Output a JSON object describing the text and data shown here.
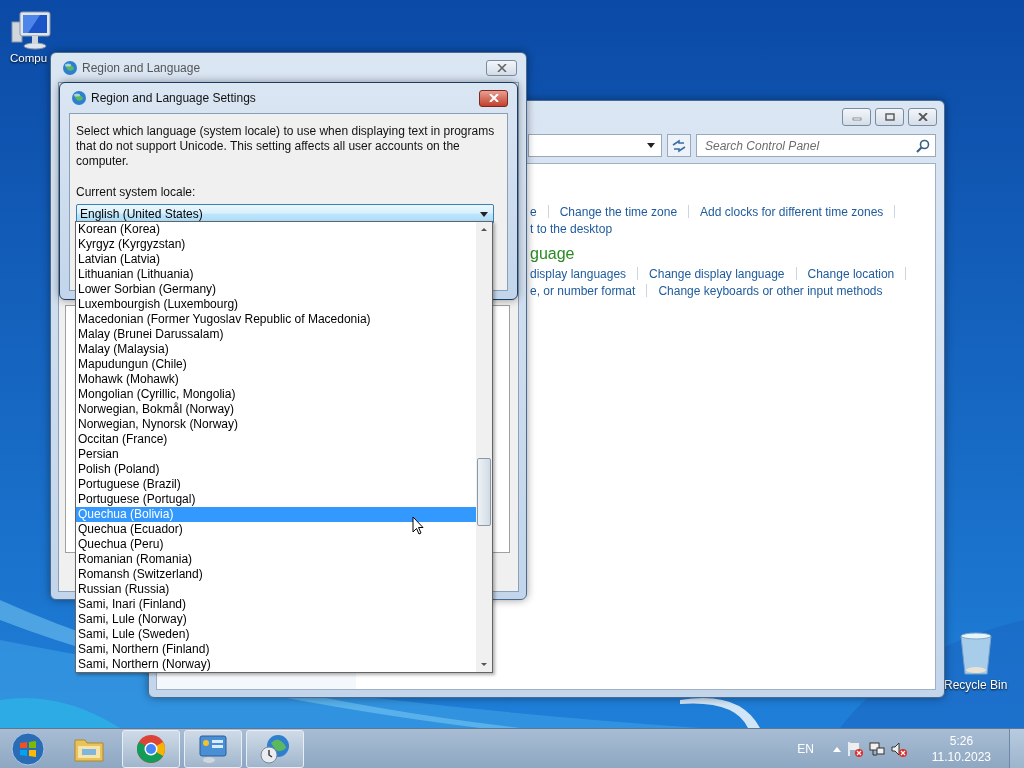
{
  "desktop_icons": [
    {
      "kind": "computer",
      "label": "Compu"
    },
    {
      "kind": "recycle",
      "label": "Recycle Bin"
    }
  ],
  "control_panel": {
    "search": {
      "placeholder": "Search Control Panel"
    },
    "rows": [
      {
        "kind": "links",
        "trailing_separator": true,
        "links": [
          "e",
          "Change the time zone",
          "Add clocks for different time zones"
        ]
      },
      {
        "kind": "links",
        "trailing_separator": false,
        "links": [
          "t to the desktop"
        ]
      },
      {
        "kind": "heading",
        "text": "guage"
      },
      {
        "kind": "links",
        "trailing_separator": true,
        "links": [
          "display languages",
          "Change display language",
          "Change location"
        ]
      },
      {
        "kind": "links",
        "trailing_separator": false,
        "links": [
          "e, or number format",
          "Change keyboards or other input methods"
        ]
      }
    ]
  },
  "region_dialog": {
    "title": "Region and Language"
  },
  "settings_dialog": {
    "title": "Region and Language Settings",
    "description": "Select which language (system locale) to use when displaying text in programs that do not support Unicode. This setting affects all user accounts on the computer.",
    "locale_label": "Current system locale:",
    "locale_value": "English (United States)",
    "options": [
      {
        "label": "Korean (Korea)",
        "selected": false
      },
      {
        "label": "Kyrgyz (Kyrgyzstan)",
        "selected": false
      },
      {
        "label": "Latvian (Latvia)",
        "selected": false
      },
      {
        "label": "Lithuanian (Lithuania)",
        "selected": false
      },
      {
        "label": "Lower Sorbian (Germany)",
        "selected": false
      },
      {
        "label": "Luxembourgish (Luxembourg)",
        "selected": false
      },
      {
        "label": "Macedonian (Former Yugoslav Republic of Macedonia)",
        "selected": false
      },
      {
        "label": "Malay (Brunei Darussalam)",
        "selected": false
      },
      {
        "label": "Malay (Malaysia)",
        "selected": false
      },
      {
        "label": "Mapudungun (Chile)",
        "selected": false
      },
      {
        "label": "Mohawk (Mohawk)",
        "selected": false
      },
      {
        "label": "Mongolian (Cyrillic, Mongolia)",
        "selected": false
      },
      {
        "label": "Norwegian, Bokmål (Norway)",
        "selected": false
      },
      {
        "label": "Norwegian, Nynorsk (Norway)",
        "selected": false
      },
      {
        "label": "Occitan (France)",
        "selected": false
      },
      {
        "label": "Persian",
        "selected": false
      },
      {
        "label": "Polish (Poland)",
        "selected": false
      },
      {
        "label": "Portuguese (Brazil)",
        "selected": false
      },
      {
        "label": "Portuguese (Portugal)",
        "selected": false
      },
      {
        "label": "Quechua (Bolivia)",
        "selected": true
      },
      {
        "label": "Quechua (Ecuador)",
        "selected": false
      },
      {
        "label": "Quechua (Peru)",
        "selected": false
      },
      {
        "label": "Romanian (Romania)",
        "selected": false
      },
      {
        "label": "Romansh (Switzerland)",
        "selected": false
      },
      {
        "label": "Russian (Russia)",
        "selected": false
      },
      {
        "label": "Sami, Inari (Finland)",
        "selected": false
      },
      {
        "label": "Sami, Lule (Norway)",
        "selected": false
      },
      {
        "label": "Sami, Lule (Sweden)",
        "selected": false
      },
      {
        "label": "Sami, Northern (Finland)",
        "selected": false
      },
      {
        "label": "Sami, Northern (Norway)",
        "selected": false
      }
    ]
  },
  "taskbar": {
    "apps": [
      {
        "kind": "explorer",
        "selected": false
      },
      {
        "kind": "browser",
        "selected": true
      },
      {
        "kind": "control_panel",
        "selected": true
      },
      {
        "kind": "region",
        "selected": true
      }
    ],
    "language": "EN",
    "time": "5:26",
    "date": "11.10.2023"
  }
}
